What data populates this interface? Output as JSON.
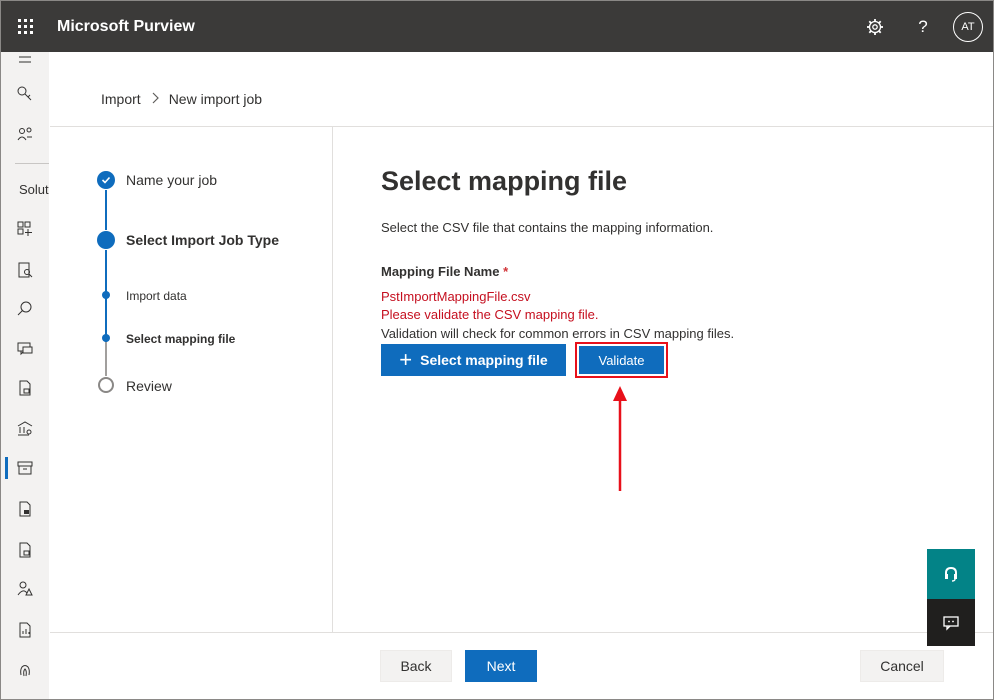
{
  "app": {
    "title": "Microsoft Purview",
    "user_initials": "AT"
  },
  "topbar": {
    "settings_icon": "gear-icon",
    "help_label": "?"
  },
  "rail": {
    "section_label": "Solut"
  },
  "breadcrumb": {
    "items": [
      "Import",
      "New import job"
    ],
    "separator": ">"
  },
  "steps": [
    {
      "label": "Name your job",
      "state": "done"
    },
    {
      "label": "Select Import Job Type",
      "state": "current"
    },
    {
      "label": "Import data",
      "state": "substep"
    },
    {
      "label": "Select mapping file",
      "state": "substep-current"
    },
    {
      "label": "Review",
      "state": "pending"
    }
  ],
  "content": {
    "title": "Select mapping file",
    "description": "Select the CSV file that contains the mapping information.",
    "field_label": "Mapping File Name",
    "required_mark": "*",
    "file_name": "PstImportMappingFile.csv",
    "validate_message": "Please validate the CSV mapping file.",
    "validation_info": "Validation will check for common errors in CSV mapping files.",
    "select_button": "Select mapping file",
    "validate_button": "Validate"
  },
  "footer": {
    "back": "Back",
    "next": "Next",
    "cancel": "Cancel"
  },
  "colors": {
    "accent": "#0f6cbd",
    "error": "#c50f1f",
    "highlight": "#e8101a",
    "topbar": "#3b3a39",
    "help": "#038387"
  }
}
